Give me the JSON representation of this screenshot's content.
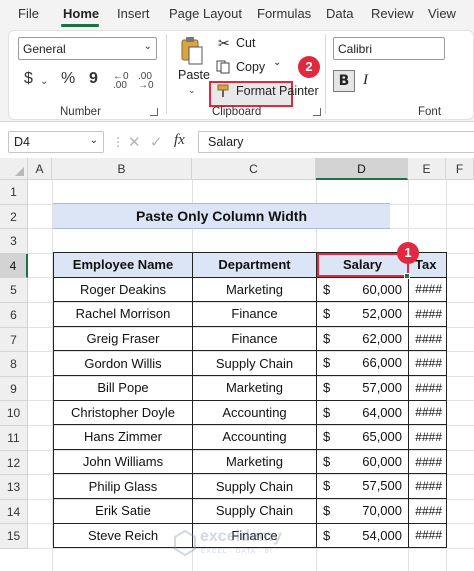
{
  "menu": {
    "tabs": [
      "File",
      "Home",
      "Insert",
      "Page Layout",
      "Formulas",
      "Data",
      "Review",
      "View"
    ],
    "active": "Home"
  },
  "ribbon": {
    "number": {
      "format_value": "General",
      "currency_symbol": "$",
      "percent_symbol": "%",
      "comma_symbol": "9",
      "label": "Number"
    },
    "clipboard": {
      "paste_label": "Paste",
      "cut_label": "Cut",
      "copy_label": "Copy",
      "format_painter_label": "Format Painter",
      "label": "Clipboard"
    },
    "font": {
      "font_name": "Calibri",
      "bold_label": "B",
      "italic_label": "I",
      "label": "Font"
    }
  },
  "formula_bar": {
    "name_box": "D4",
    "fx_label": "fx",
    "content": "Salary"
  },
  "grid": {
    "columns": [
      "A",
      "B",
      "C",
      "D",
      "E",
      "F"
    ],
    "selected_column": "D",
    "rows": [
      "1",
      "2",
      "3",
      "4",
      "5",
      "6",
      "7",
      "8",
      "9",
      "10",
      "11",
      "12",
      "13",
      "14",
      "15"
    ],
    "selected_row": "4"
  },
  "sheet": {
    "title": "Paste Only Column Width",
    "headers": [
      "Employee Name",
      "Department",
      "Salary",
      "Tax"
    ],
    "rows": [
      {
        "name": "Roger Deakins",
        "dept": "Marketing",
        "cur": "$",
        "salary": "60,000",
        "tax": "####"
      },
      {
        "name": "Rachel Morrison",
        "dept": "Finance",
        "cur": "$",
        "salary": "52,000",
        "tax": "####"
      },
      {
        "name": "Greig Fraser",
        "dept": "Finance",
        "cur": "$",
        "salary": "62,000",
        "tax": "####"
      },
      {
        "name": "Gordon Willis",
        "dept": "Supply Chain",
        "cur": "$",
        "salary": "66,000",
        "tax": "####"
      },
      {
        "name": "Bill Pope",
        "dept": "Marketing",
        "cur": "$",
        "salary": "57,000",
        "tax": "####"
      },
      {
        "name": "Christopher Doyle",
        "dept": "Accounting",
        "cur": "$",
        "salary": "64,000",
        "tax": "####"
      },
      {
        "name": "Hans Zimmer",
        "dept": "Accounting",
        "cur": "$",
        "salary": "65,000",
        "tax": "####"
      },
      {
        "name": "John Williams",
        "dept": "Marketing",
        "cur": "$",
        "salary": "60,000",
        "tax": "####"
      },
      {
        "name": "Philip Glass",
        "dept": "Supply Chain",
        "cur": "$",
        "salary": "57,500",
        "tax": "####"
      },
      {
        "name": "Erik Satie",
        "dept": "Supply Chain",
        "cur": "$",
        "salary": "70,000",
        "tax": "####"
      },
      {
        "name": "Steve Reich",
        "dept": "Finance",
        "cur": "$",
        "salary": "54,000",
        "tax": "####"
      }
    ]
  },
  "annotations": {
    "step1": "1",
    "step2": "2",
    "highlight_color": "#e0293e"
  },
  "watermark": {
    "name": "exceldemy",
    "tagline": "EXCEL · DATA · BI"
  },
  "colors": {
    "accent": "#1e7145",
    "header_fill": "#dbe5f5"
  }
}
